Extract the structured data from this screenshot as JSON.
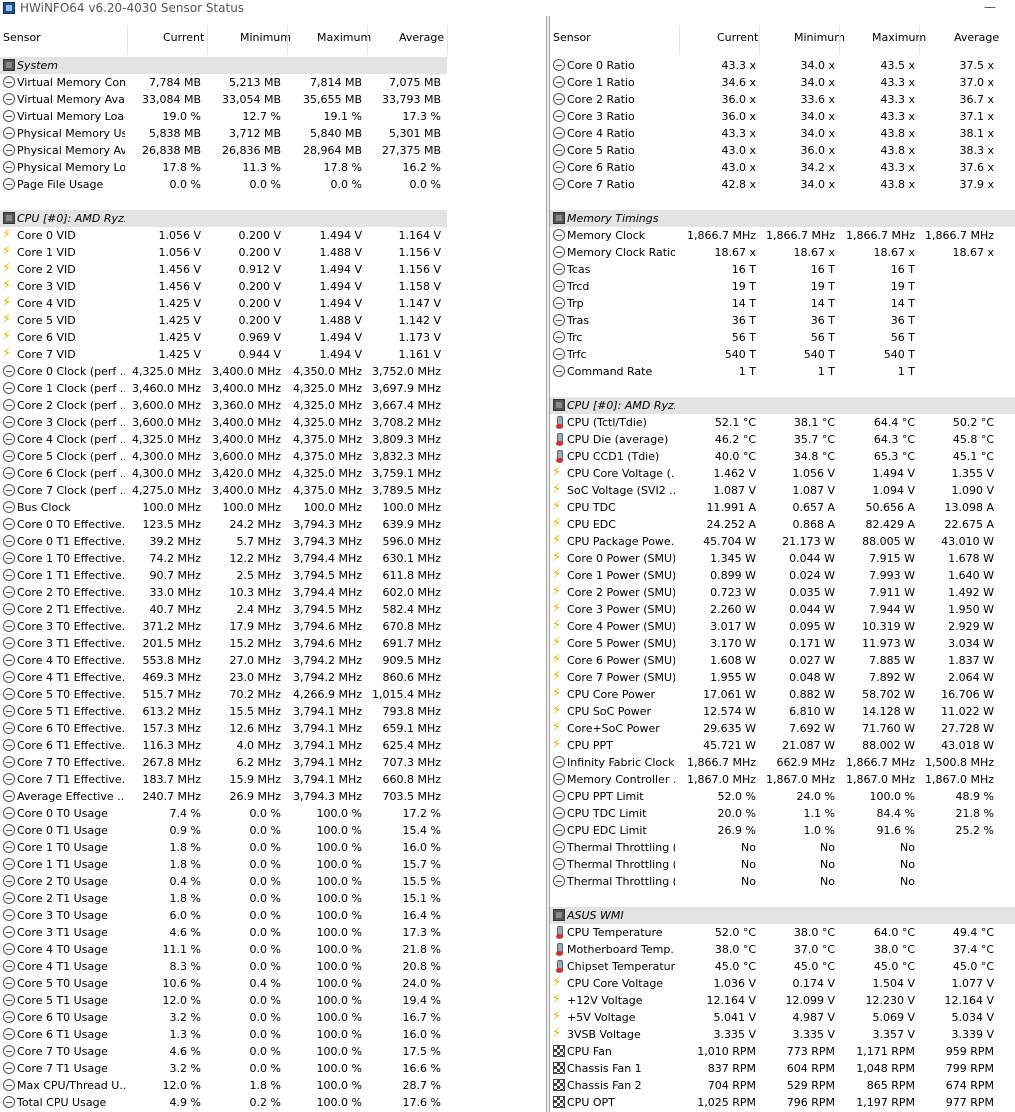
{
  "window": {
    "title": "HWiNFO64 v6.20-4030 Sensor Status",
    "minimize_glyph": "—"
  },
  "columns": {
    "sensor": "Sensor",
    "current": "Current",
    "minimum": "Minimum",
    "maximum": "Maximum",
    "average": "Average"
  },
  "left_rows": [
    {
      "g": "System",
      "icon": "chip"
    },
    {
      "l": "Virtual Memory Com...",
      "i": "s",
      "c": "7,784 MB",
      "mn": "5,213 MB",
      "mx": "7,814 MB",
      "a": "7,075 MB"
    },
    {
      "l": "Virtual Memory Avai...",
      "i": "s",
      "c": "33,084 MB",
      "mn": "33,054 MB",
      "mx": "35,655 MB",
      "a": "33,793 MB"
    },
    {
      "l": "Virtual Memory Load",
      "i": "s",
      "c": "19.0 %",
      "mn": "12.7 %",
      "mx": "19.1 %",
      "a": "17.3 %"
    },
    {
      "l": "Physical Memory Used",
      "i": "s",
      "c": "5,838 MB",
      "mn": "3,712 MB",
      "mx": "5,840 MB",
      "a": "5,301 MB"
    },
    {
      "l": "Physical Memory Av...",
      "i": "s",
      "c": "26,838 MB",
      "mn": "26,836 MB",
      "mx": "28,964 MB",
      "a": "27,375 MB"
    },
    {
      "l": "Physical Memory Load",
      "i": "s",
      "c": "17.8 %",
      "mn": "11.3 %",
      "mx": "17.8 %",
      "a": "16.2 %"
    },
    {
      "l": "Page File Usage",
      "i": "s",
      "c": "0.0 %",
      "mn": "0.0 %",
      "mx": "0.0 %",
      "a": "0.0 %"
    },
    {
      "blank": true
    },
    {
      "g": "CPU [#0]: AMD Ryz...",
      "icon": "chip"
    },
    {
      "l": "Core 0 VID",
      "i": "v",
      "c": "1.056 V",
      "mn": "0.200 V",
      "mx": "1.494 V",
      "a": "1.164 V"
    },
    {
      "l": "Core 1 VID",
      "i": "v",
      "c": "1.056 V",
      "mn": "0.200 V",
      "mx": "1.488 V",
      "a": "1.156 V"
    },
    {
      "l": "Core 2 VID",
      "i": "v",
      "c": "1.456 V",
      "mn": "0.912 V",
      "mx": "1.494 V",
      "a": "1.156 V"
    },
    {
      "l": "Core 3 VID",
      "i": "v",
      "c": "1.456 V",
      "mn": "0.200 V",
      "mx": "1.494 V",
      "a": "1.158 V"
    },
    {
      "l": "Core 4 VID",
      "i": "v",
      "c": "1.425 V",
      "mn": "0.200 V",
      "mx": "1.494 V",
      "a": "1.147 V"
    },
    {
      "l": "Core 5 VID",
      "i": "v",
      "c": "1.425 V",
      "mn": "0.200 V",
      "mx": "1.488 V",
      "a": "1.142 V"
    },
    {
      "l": "Core 6 VID",
      "i": "v",
      "c": "1.425 V",
      "mn": "0.969 V",
      "mx": "1.494 V",
      "a": "1.173 V"
    },
    {
      "l": "Core 7 VID",
      "i": "v",
      "c": "1.425 V",
      "mn": "0.944 V",
      "mx": "1.494 V",
      "a": "1.161 V"
    },
    {
      "l": "Core 0 Clock (perf ...",
      "i": "s",
      "c": "4,325.0 MHz",
      "mn": "3,400.0 MHz",
      "mx": "4,350.0 MHz",
      "a": "3,752.0 MHz"
    },
    {
      "l": "Core 1 Clock (perf ...",
      "i": "s",
      "c": "3,460.0 MHz",
      "mn": "3,400.0 MHz",
      "mx": "4,325.0 MHz",
      "a": "3,697.9 MHz"
    },
    {
      "l": "Core 2 Clock (perf ...",
      "i": "s",
      "c": "3,600.0 MHz",
      "mn": "3,360.0 MHz",
      "mx": "4,325.0 MHz",
      "a": "3,667.4 MHz"
    },
    {
      "l": "Core 3 Clock (perf ...",
      "i": "s",
      "c": "3,600.0 MHz",
      "mn": "3,400.0 MHz",
      "mx": "4,325.0 MHz",
      "a": "3,708.2 MHz"
    },
    {
      "l": "Core 4 Clock (perf ...",
      "i": "s",
      "c": "4,325.0 MHz",
      "mn": "3,400.0 MHz",
      "mx": "4,375.0 MHz",
      "a": "3,809.3 MHz"
    },
    {
      "l": "Core 5 Clock (perf ...",
      "i": "s",
      "c": "4,300.0 MHz",
      "mn": "3,600.0 MHz",
      "mx": "4,375.0 MHz",
      "a": "3,832.3 MHz"
    },
    {
      "l": "Core 6 Clock (perf ...",
      "i": "s",
      "c": "4,300.0 MHz",
      "mn": "3,420.0 MHz",
      "mx": "4,325.0 MHz",
      "a": "3,759.1 MHz"
    },
    {
      "l": "Core 7 Clock (perf ...",
      "i": "s",
      "c": "4,275.0 MHz",
      "mn": "3,400.0 MHz",
      "mx": "4,375.0 MHz",
      "a": "3,789.5 MHz"
    },
    {
      "l": "Bus Clock",
      "i": "s",
      "c": "100.0 MHz",
      "mn": "100.0 MHz",
      "mx": "100.0 MHz",
      "a": "100.0 MHz"
    },
    {
      "l": "Core 0 T0 Effective...",
      "i": "s",
      "c": "123.5 MHz",
      "mn": "24.2 MHz",
      "mx": "3,794.3 MHz",
      "a": "639.9 MHz"
    },
    {
      "l": "Core 0 T1 Effective...",
      "i": "s",
      "c": "39.2 MHz",
      "mn": "5.7 MHz",
      "mx": "3,794.3 MHz",
      "a": "596.0 MHz"
    },
    {
      "l": "Core 1 T0 Effective...",
      "i": "s",
      "c": "74.2 MHz",
      "mn": "12.2 MHz",
      "mx": "3,794.4 MHz",
      "a": "630.1 MHz"
    },
    {
      "l": "Core 1 T1 Effective...",
      "i": "s",
      "c": "90.7 MHz",
      "mn": "2.5 MHz",
      "mx": "3,794.5 MHz",
      "a": "611.8 MHz"
    },
    {
      "l": "Core 2 T0 Effective...",
      "i": "s",
      "c": "33.0 MHz",
      "mn": "10.3 MHz",
      "mx": "3,794.4 MHz",
      "a": "602.0 MHz"
    },
    {
      "l": "Core 2 T1 Effective...",
      "i": "s",
      "c": "40.7 MHz",
      "mn": "2.4 MHz",
      "mx": "3,794.5 MHz",
      "a": "582.4 MHz"
    },
    {
      "l": "Core 3 T0 Effective...",
      "i": "s",
      "c": "371.2 MHz",
      "mn": "17.9 MHz",
      "mx": "3,794.6 MHz",
      "a": "670.8 MHz"
    },
    {
      "l": "Core 3 T1 Effective...",
      "i": "s",
      "c": "201.5 MHz",
      "mn": "15.2 MHz",
      "mx": "3,794.6 MHz",
      "a": "691.7 MHz"
    },
    {
      "l": "Core 4 T0 Effective...",
      "i": "s",
      "c": "553.8 MHz",
      "mn": "27.0 MHz",
      "mx": "3,794.2 MHz",
      "a": "909.5 MHz"
    },
    {
      "l": "Core 4 T1 Effective...",
      "i": "s",
      "c": "469.3 MHz",
      "mn": "23.0 MHz",
      "mx": "3,794.2 MHz",
      "a": "860.6 MHz"
    },
    {
      "l": "Core 5 T0 Effective...",
      "i": "s",
      "c": "515.7 MHz",
      "mn": "70.2 MHz",
      "mx": "4,266.9 MHz",
      "a": "1,015.4 MHz"
    },
    {
      "l": "Core 5 T1 Effective...",
      "i": "s",
      "c": "613.2 MHz",
      "mn": "15.5 MHz",
      "mx": "3,794.1 MHz",
      "a": "793.8 MHz"
    },
    {
      "l": "Core 6 T0 Effective...",
      "i": "s",
      "c": "157.3 MHz",
      "mn": "12.6 MHz",
      "mx": "3,794.1 MHz",
      "a": "659.1 MHz"
    },
    {
      "l": "Core 6 T1 Effective...",
      "i": "s",
      "c": "116.3 MHz",
      "mn": "4.0 MHz",
      "mx": "3,794.1 MHz",
      "a": "625.4 MHz"
    },
    {
      "l": "Core 7 T0 Effective...",
      "i": "s",
      "c": "267.8 MHz",
      "mn": "6.2 MHz",
      "mx": "3,794.1 MHz",
      "a": "707.3 MHz"
    },
    {
      "l": "Core 7 T1 Effective...",
      "i": "s",
      "c": "183.7 MHz",
      "mn": "15.9 MHz",
      "mx": "3,794.1 MHz",
      "a": "660.8 MHz"
    },
    {
      "l": "Average Effective ...",
      "i": "s",
      "c": "240.7 MHz",
      "mn": "26.9 MHz",
      "mx": "3,794.3 MHz",
      "a": "703.5 MHz"
    },
    {
      "l": "Core 0 T0 Usage",
      "i": "s",
      "c": "7.4 %",
      "mn": "0.0 %",
      "mx": "100.0 %",
      "a": "17.2 %"
    },
    {
      "l": "Core 0 T1 Usage",
      "i": "s",
      "c": "0.9 %",
      "mn": "0.0 %",
      "mx": "100.0 %",
      "a": "15.4 %"
    },
    {
      "l": "Core 1 T0 Usage",
      "i": "s",
      "c": "1.8 %",
      "mn": "0.0 %",
      "mx": "100.0 %",
      "a": "16.0 %"
    },
    {
      "l": "Core 1 T1 Usage",
      "i": "s",
      "c": "1.8 %",
      "mn": "0.0 %",
      "mx": "100.0 %",
      "a": "15.7 %"
    },
    {
      "l": "Core 2 T0 Usage",
      "i": "s",
      "c": "0.4 %",
      "mn": "0.0 %",
      "mx": "100.0 %",
      "a": "15.5 %"
    },
    {
      "l": "Core 2 T1 Usage",
      "i": "s",
      "c": "1.8 %",
      "mn": "0.0 %",
      "mx": "100.0 %",
      "a": "15.1 %"
    },
    {
      "l": "Core 3 T0 Usage",
      "i": "s",
      "c": "6.0 %",
      "mn": "0.0 %",
      "mx": "100.0 %",
      "a": "16.4 %"
    },
    {
      "l": "Core 3 T1 Usage",
      "i": "s",
      "c": "4.6 %",
      "mn": "0.0 %",
      "mx": "100.0 %",
      "a": "17.3 %"
    },
    {
      "l": "Core 4 T0 Usage",
      "i": "s",
      "c": "11.1 %",
      "mn": "0.0 %",
      "mx": "100.0 %",
      "a": "21.8 %"
    },
    {
      "l": "Core 4 T1 Usage",
      "i": "s",
      "c": "8.3 %",
      "mn": "0.0 %",
      "mx": "100.0 %",
      "a": "20.8 %"
    },
    {
      "l": "Core 5 T0 Usage",
      "i": "s",
      "c": "10.6 %",
      "mn": "0.4 %",
      "mx": "100.0 %",
      "a": "24.0 %"
    },
    {
      "l": "Core 5 T1 Usage",
      "i": "s",
      "c": "12.0 %",
      "mn": "0.0 %",
      "mx": "100.0 %",
      "a": "19.4 %"
    },
    {
      "l": "Core 6 T0 Usage",
      "i": "s",
      "c": "3.2 %",
      "mn": "0.0 %",
      "mx": "100.0 %",
      "a": "16.7 %"
    },
    {
      "l": "Core 6 T1 Usage",
      "i": "s",
      "c": "1.3 %",
      "mn": "0.0 %",
      "mx": "100.0 %",
      "a": "16.0 %"
    },
    {
      "l": "Core 7 T0 Usage",
      "i": "s",
      "c": "4.6 %",
      "mn": "0.0 %",
      "mx": "100.0 %",
      "a": "17.5 %"
    },
    {
      "l": "Core 7 T1 Usage",
      "i": "s",
      "c": "3.2 %",
      "mn": "0.0 %",
      "mx": "100.0 %",
      "a": "16.6 %"
    },
    {
      "l": "Max CPU/Thread U...",
      "i": "s",
      "c": "12.0 %",
      "mn": "1.8 %",
      "mx": "100.0 %",
      "a": "28.7 %"
    },
    {
      "l": "Total CPU Usage",
      "i": "s",
      "c": "4.9 %",
      "mn": "0.2 %",
      "mx": "100.0 %",
      "a": "17.6 %"
    }
  ],
  "right_rows": [
    {
      "l": "Core 0 Ratio",
      "i": "s",
      "c": "43.3 x",
      "mn": "34.0 x",
      "mx": "43.5 x",
      "a": "37.5 x"
    },
    {
      "l": "Core 1 Ratio",
      "i": "s",
      "c": "34.6 x",
      "mn": "34.0 x",
      "mx": "43.3 x",
      "a": "37.0 x"
    },
    {
      "l": "Core 2 Ratio",
      "i": "s",
      "c": "36.0 x",
      "mn": "33.6 x",
      "mx": "43.3 x",
      "a": "36.7 x"
    },
    {
      "l": "Core 3 Ratio",
      "i": "s",
      "c": "36.0 x",
      "mn": "34.0 x",
      "mx": "43.3 x",
      "a": "37.1 x"
    },
    {
      "l": "Core 4 Ratio",
      "i": "s",
      "c": "43.3 x",
      "mn": "34.0 x",
      "mx": "43.8 x",
      "a": "38.1 x"
    },
    {
      "l": "Core 5 Ratio",
      "i": "s",
      "c": "43.0 x",
      "mn": "36.0 x",
      "mx": "43.8 x",
      "a": "38.3 x"
    },
    {
      "l": "Core 6 Ratio",
      "i": "s",
      "c": "43.0 x",
      "mn": "34.2 x",
      "mx": "43.3 x",
      "a": "37.6 x"
    },
    {
      "l": "Core 7 Ratio",
      "i": "s",
      "c": "42.8 x",
      "mn": "34.0 x",
      "mx": "43.8 x",
      "a": "37.9 x"
    },
    {
      "blank": true
    },
    {
      "g": "Memory Timings",
      "icon": "chip"
    },
    {
      "l": "Memory Clock",
      "i": "s",
      "c": "1,866.7 MHz",
      "mn": "1,866.7 MHz",
      "mx": "1,866.7 MHz",
      "a": "1,866.7 MHz"
    },
    {
      "l": "Memory Clock Ratio",
      "i": "s",
      "c": "18.67 x",
      "mn": "18.67 x",
      "mx": "18.67 x",
      "a": "18.67 x"
    },
    {
      "l": "Tcas",
      "i": "s",
      "c": "16 T",
      "mn": "16 T",
      "mx": "16 T",
      "a": ""
    },
    {
      "l": "Trcd",
      "i": "s",
      "c": "19 T",
      "mn": "19 T",
      "mx": "19 T",
      "a": ""
    },
    {
      "l": "Trp",
      "i": "s",
      "c": "14 T",
      "mn": "14 T",
      "mx": "14 T",
      "a": ""
    },
    {
      "l": "Tras",
      "i": "s",
      "c": "36 T",
      "mn": "36 T",
      "mx": "36 T",
      "a": ""
    },
    {
      "l": "Trc",
      "i": "s",
      "c": "56 T",
      "mn": "56 T",
      "mx": "56 T",
      "a": ""
    },
    {
      "l": "Trfc",
      "i": "s",
      "c": "540 T",
      "mn": "540 T",
      "mx": "540 T",
      "a": ""
    },
    {
      "l": "Command Rate",
      "i": "s",
      "c": "1 T",
      "mn": "1 T",
      "mx": "1 T",
      "a": ""
    },
    {
      "blank": true
    },
    {
      "g": "CPU [#0]: AMD Ryz...",
      "icon": "chip"
    },
    {
      "l": "CPU (Tctl/Tdie)",
      "i": "t",
      "c": "52.1 °C",
      "mn": "38.1 °C",
      "mx": "64.4 °C",
      "a": "50.2 °C"
    },
    {
      "l": "CPU Die (average)",
      "i": "t",
      "c": "46.2 °C",
      "mn": "35.7 °C",
      "mx": "64.3 °C",
      "a": "45.8 °C"
    },
    {
      "l": "CPU CCD1 (Tdie)",
      "i": "t",
      "c": "40.0 °C",
      "mn": "34.8 °C",
      "mx": "65.3 °C",
      "a": "45.1 °C"
    },
    {
      "l": "CPU Core Voltage (...",
      "i": "v",
      "c": "1.462 V",
      "mn": "1.056 V",
      "mx": "1.494 V",
      "a": "1.355 V"
    },
    {
      "l": "SoC Voltage (SVI2 ...",
      "i": "v",
      "c": "1.087 V",
      "mn": "1.087 V",
      "mx": "1.094 V",
      "a": "1.090 V"
    },
    {
      "l": "CPU TDC",
      "i": "v",
      "c": "11.991 A",
      "mn": "0.657 A",
      "mx": "50.656 A",
      "a": "13.098 A"
    },
    {
      "l": "CPU EDC",
      "i": "v",
      "c": "24.252 A",
      "mn": "0.868 A",
      "mx": "82.429 A",
      "a": "22.675 A"
    },
    {
      "l": "CPU Package Powe...",
      "i": "v",
      "c": "45.704 W",
      "mn": "21.173 W",
      "mx": "88.005 W",
      "a": "43.010 W"
    },
    {
      "l": "Core 0 Power (SMU)",
      "i": "v",
      "c": "1.345 W",
      "mn": "0.044 W",
      "mx": "7.915 W",
      "a": "1.678 W"
    },
    {
      "l": "Core 1 Power (SMU)",
      "i": "v",
      "c": "0.899 W",
      "mn": "0.024 W",
      "mx": "7.993 W",
      "a": "1.640 W"
    },
    {
      "l": "Core 2 Power (SMU)",
      "i": "v",
      "c": "0.723 W",
      "mn": "0.035 W",
      "mx": "7.911 W",
      "a": "1.492 W"
    },
    {
      "l": "Core 3 Power (SMU)",
      "i": "v",
      "c": "2.260 W",
      "mn": "0.044 W",
      "mx": "7.944 W",
      "a": "1.950 W"
    },
    {
      "l": "Core 4 Power (SMU)",
      "i": "v",
      "c": "3.017 W",
      "mn": "0.095 W",
      "mx": "10.319 W",
      "a": "2.929 W"
    },
    {
      "l": "Core 5 Power (SMU)",
      "i": "v",
      "c": "3.170 W",
      "mn": "0.171 W",
      "mx": "11.973 W",
      "a": "3.034 W"
    },
    {
      "l": "Core 6 Power (SMU)",
      "i": "v",
      "c": "1.608 W",
      "mn": "0.027 W",
      "mx": "7.885 W",
      "a": "1.837 W"
    },
    {
      "l": "Core 7 Power (SMU)",
      "i": "v",
      "c": "1.955 W",
      "mn": "0.048 W",
      "mx": "7.892 W",
      "a": "2.064 W"
    },
    {
      "l": "CPU Core Power",
      "i": "v",
      "c": "17.061 W",
      "mn": "0.882 W",
      "mx": "58.702 W",
      "a": "16.706 W"
    },
    {
      "l": "CPU SoC Power",
      "i": "v",
      "c": "12.574 W",
      "mn": "6.810 W",
      "mx": "14.128 W",
      "a": "11.022 W"
    },
    {
      "l": "Core+SoC Power",
      "i": "v",
      "c": "29.635 W",
      "mn": "7.692 W",
      "mx": "71.760 W",
      "a": "27.728 W"
    },
    {
      "l": "CPU PPT",
      "i": "v",
      "c": "45.721 W",
      "mn": "21.087 W",
      "mx": "88.002 W",
      "a": "43.018 W"
    },
    {
      "l": "Infinity Fabric Clock...",
      "i": "s",
      "c": "1,866.7 MHz",
      "mn": "662.9 MHz",
      "mx": "1,866.7 MHz",
      "a": "1,500.8 MHz"
    },
    {
      "l": "Memory Controller ...",
      "i": "s",
      "c": "1,867.0 MHz",
      "mn": "1,867.0 MHz",
      "mx": "1,867.0 MHz",
      "a": "1,867.0 MHz"
    },
    {
      "l": "CPU PPT Limit",
      "i": "s",
      "c": "52.0 %",
      "mn": "24.0 %",
      "mx": "100.0 %",
      "a": "48.9 %"
    },
    {
      "l": "CPU TDC Limit",
      "i": "s",
      "c": "20.0 %",
      "mn": "1.1 %",
      "mx": "84.4 %",
      "a": "21.8 %"
    },
    {
      "l": "CPU EDC Limit",
      "i": "s",
      "c": "26.9 %",
      "mn": "1.0 %",
      "mx": "91.6 %",
      "a": "25.2 %"
    },
    {
      "l": "Thermal Throttling (...",
      "i": "s",
      "c": "No",
      "mn": "No",
      "mx": "No",
      "a": ""
    },
    {
      "l": "Thermal Throttling (...",
      "i": "s",
      "c": "No",
      "mn": "No",
      "mx": "No",
      "a": ""
    },
    {
      "l": "Thermal Throttling (...",
      "i": "s",
      "c": "No",
      "mn": "No",
      "mx": "No",
      "a": ""
    },
    {
      "blank": true
    },
    {
      "g": "ASUS WMI",
      "icon": "chip"
    },
    {
      "l": "CPU Temperature",
      "i": "t",
      "c": "52.0 °C",
      "mn": "38.0 °C",
      "mx": "64.0 °C",
      "a": "49.4 °C"
    },
    {
      "l": "Motherboard Temp...",
      "i": "t",
      "c": "38.0 °C",
      "mn": "37.0 °C",
      "mx": "38.0 °C",
      "a": "37.4 °C"
    },
    {
      "l": "Chipset Temperature",
      "i": "t",
      "c": "45.0 °C",
      "mn": "45.0 °C",
      "mx": "45.0 °C",
      "a": "45.0 °C"
    },
    {
      "l": "CPU Core Voltage",
      "i": "v",
      "c": "1.036 V",
      "mn": "0.174 V",
      "mx": "1.504 V",
      "a": "1.077 V"
    },
    {
      "l": "+12V Voltage",
      "i": "v",
      "c": "12.164 V",
      "mn": "12.099 V",
      "mx": "12.230 V",
      "a": "12.164 V"
    },
    {
      "l": "+5V Voltage",
      "i": "v",
      "c": "5.041 V",
      "mn": "4.987 V",
      "mx": "5.069 V",
      "a": "5.034 V"
    },
    {
      "l": "3VSB Voltage",
      "i": "v",
      "c": "3.335 V",
      "mn": "3.335 V",
      "mx": "3.357 V",
      "a": "3.339 V"
    },
    {
      "l": "CPU Fan",
      "i": "f",
      "c": "1,010 RPM",
      "mn": "773 RPM",
      "mx": "1,171 RPM",
      "a": "959 RPM"
    },
    {
      "l": "Chassis Fan 1",
      "i": "f",
      "c": "837 RPM",
      "mn": "604 RPM",
      "mx": "1,048 RPM",
      "a": "799 RPM"
    },
    {
      "l": "Chassis Fan 2",
      "i": "f",
      "c": "704 RPM",
      "mn": "529 RPM",
      "mx": "865 RPM",
      "a": "674 RPM"
    },
    {
      "l": "CPU OPT",
      "i": "f",
      "c": "1,025 RPM",
      "mn": "796 RPM",
      "mx": "1,197 RPM",
      "a": "977 RPM"
    }
  ]
}
